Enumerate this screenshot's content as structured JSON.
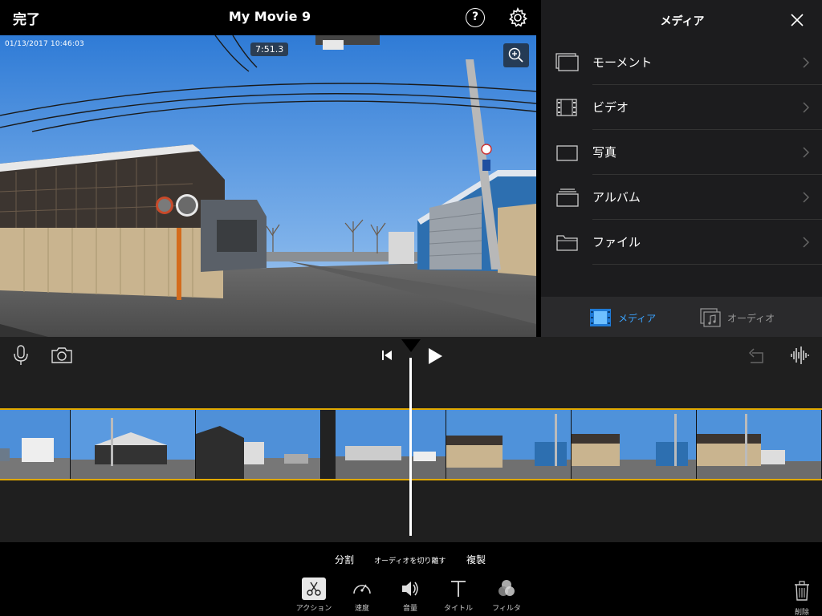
{
  "topbar": {
    "done_label": "完了",
    "title": "My Movie 9"
  },
  "viewer": {
    "timestamp": "01/13/2017    10:46:03",
    "duration": "7:51.3"
  },
  "media_panel": {
    "title": "メディア",
    "items": [
      {
        "label": "モーメント",
        "icon": "moments-icon"
      },
      {
        "label": "ビデオ",
        "icon": "film-icon"
      },
      {
        "label": "写真",
        "icon": "photo-icon"
      },
      {
        "label": "アルバム",
        "icon": "album-icon"
      },
      {
        "label": "ファイル",
        "icon": "folder-icon"
      }
    ],
    "tabs": {
      "media": "メディア",
      "audio": "オーディオ"
    },
    "accent_color": "#3aa3ff"
  },
  "actions": {
    "split": "分割",
    "detach_audio": "オーディオを切り離す",
    "duplicate": "複製"
  },
  "tools": {
    "action": "アクション",
    "speed": "速度",
    "volume": "音量",
    "title": "タイトル",
    "filter": "フィルタ",
    "delete": "削除"
  },
  "timeline": {
    "clip_border_color": "#e0a800"
  }
}
